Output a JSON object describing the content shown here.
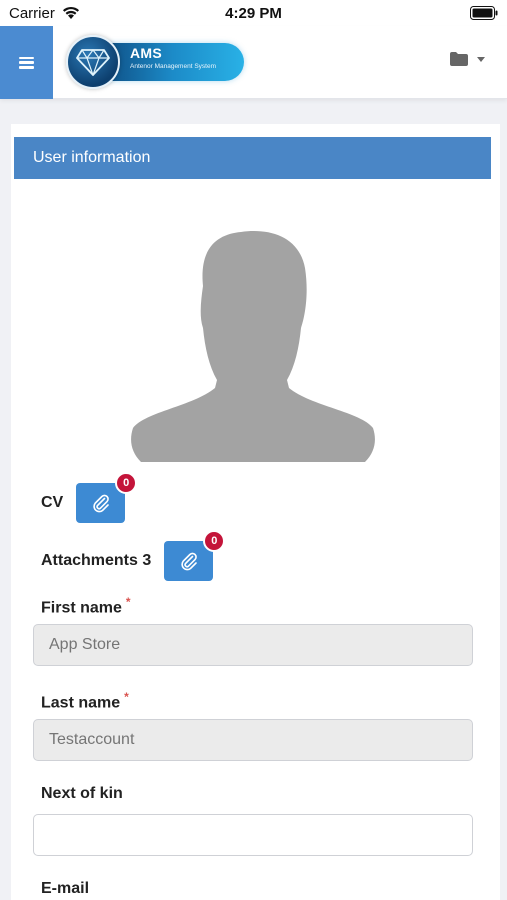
{
  "status_bar": {
    "carrier": "Carrier",
    "time": "4:29 PM"
  },
  "header": {
    "logo_title": "AMS",
    "logo_subtitle": "Antenor Management System",
    "menu_icon": "hamburger-icon",
    "folder_icon": "folder-icon"
  },
  "card": {
    "title": "User information",
    "cv": {
      "label": "CV",
      "badge": "0"
    },
    "attachments": {
      "label": "Attachments 3",
      "badge": "0"
    },
    "fields": {
      "first_name": {
        "label": "First name",
        "required": "*",
        "placeholder": "App Store"
      },
      "last_name": {
        "label": "Last name",
        "required": "*",
        "placeholder": "Testaccount"
      },
      "next_of_kin": {
        "label": "Next of kin",
        "value": ""
      },
      "email": {
        "label": "E-mail"
      }
    }
  },
  "colors": {
    "header_accent": "#4b8bd1",
    "card_title_bg": "#4a86c6",
    "button_blue": "#3d8ad3",
    "badge_red": "#c4143a"
  }
}
